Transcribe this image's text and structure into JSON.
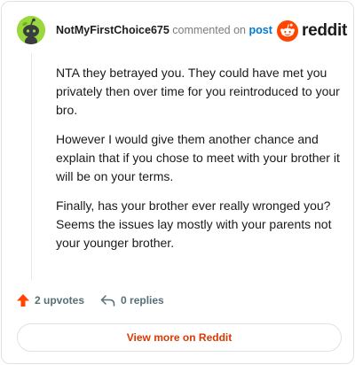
{
  "header": {
    "username": "NotMyFirstChoice675",
    "action_text": "commented on",
    "post_link": "post",
    "brand": "reddit"
  },
  "comment": {
    "paragraphs": [
      "NTA they betrayed you. They could have met you privately then over time for you reintroduced to your bro.",
      "However I would give them another chance and explain that if you chose to meet with your brother it will be on your terms.",
      "Finally, has your brother ever really wronged you? Seems the issues lay mostly with your parents not your younger brother."
    ]
  },
  "actions": {
    "upvotes": "2 upvotes",
    "replies": "0 replies"
  },
  "view_more_label": "View more on Reddit",
  "icons": {
    "avatar": "snoo-avatar-icon",
    "brand": "reddit-logo-icon",
    "upvote": "upvote-arrow-icon",
    "reply": "reply-arrow-icon"
  },
  "colors": {
    "brand_orange": "#ff4500",
    "link_blue": "#0079d3",
    "view_more_text": "#d93a00",
    "avatar_green": "#9ad83d"
  }
}
